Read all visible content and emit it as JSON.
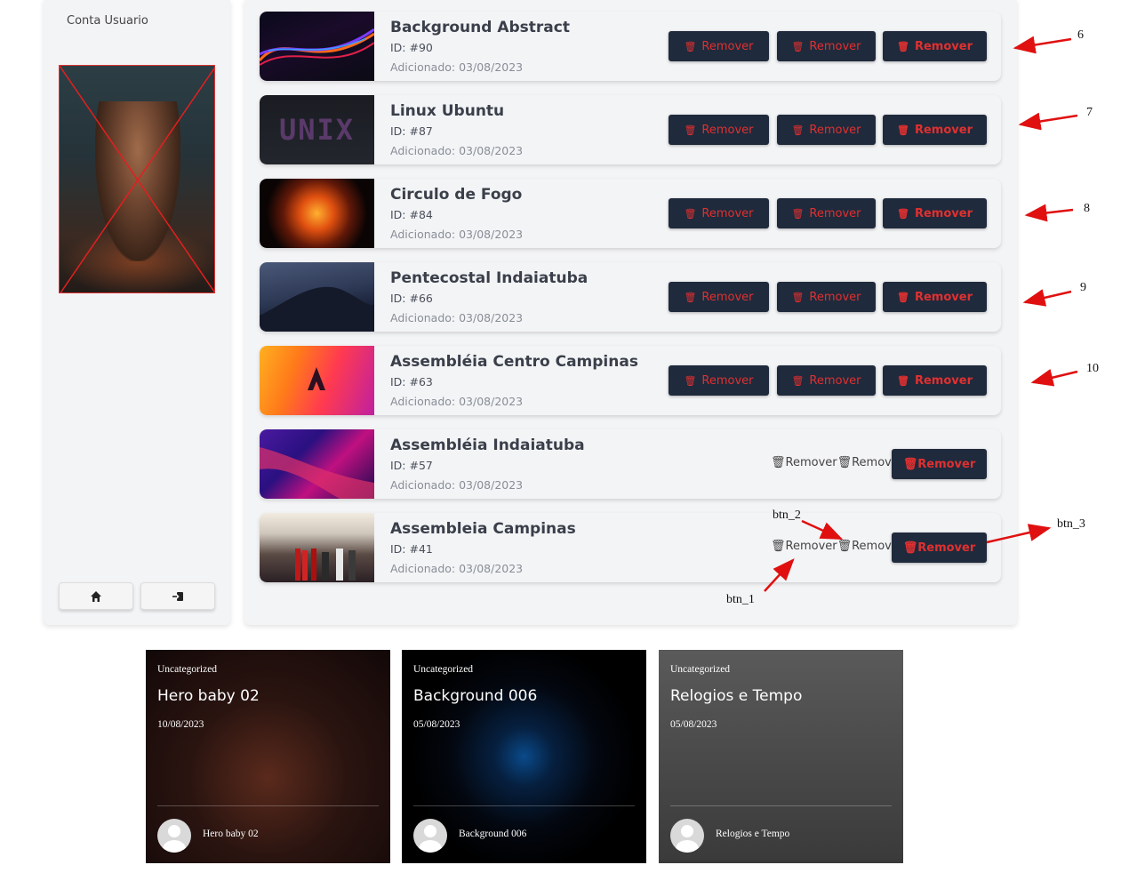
{
  "sidebar": {
    "account_label": "Conta Usuario",
    "home_icon": "home-icon",
    "logout_icon": "logout-icon"
  },
  "rows": [
    {
      "title": "Background Abstract",
      "id": "ID: #90",
      "added": "Adicionado: 03/08/2023",
      "b1": "Remover",
      "b2": "Remover",
      "b3": "Remover",
      "anno": "6"
    },
    {
      "title": "Linux Ubuntu",
      "id": "ID: #87",
      "added": "Adicionado: 03/08/2023",
      "b1": "Remover",
      "b2": "Remover",
      "b3": "Remover",
      "anno": "7",
      "thumb_text": "UNIX"
    },
    {
      "title": "Circulo de Fogo",
      "id": "ID: #84",
      "added": "Adicionado: 03/08/2023",
      "b1": "Remover",
      "b2": "Remover",
      "b3": "Remover",
      "anno": "8"
    },
    {
      "title": "Pentecostal Indaiatuba",
      "id": "ID: #66",
      "added": "Adicionado: 03/08/2023",
      "b1": "Remover",
      "b2": "Remover",
      "b3": "Remover",
      "anno": "9"
    },
    {
      "title": "Assembléia Centro Campinas",
      "id": "ID: #63",
      "added": "Adicionado: 03/08/2023",
      "b1": "Remover",
      "b2": "Remover",
      "b3": "Remover",
      "anno": "10"
    },
    {
      "title": "Assembléia Indaiatuba",
      "id": "ID: #57",
      "added": "Adicionado: 03/08/2023",
      "plain": "🗑Remover🗑Remover",
      "b3": "🗑Remover"
    },
    {
      "title": "Assembleia Campinas",
      "id": "ID: #41",
      "added": "Adicionado: 03/08/2023",
      "plain": "🗑Remover🗑Remover",
      "b3": "🗑Remover"
    }
  ],
  "annotations": {
    "btn1": "btn_1",
    "btn2": "btn_2",
    "btn3": "btn_3"
  },
  "cards": [
    {
      "category": "Uncategorized",
      "title": "Hero baby 02",
      "date": "10/08/2023",
      "author": "Hero baby 02"
    },
    {
      "category": "Uncategorized",
      "title": "Background 006",
      "date": "05/08/2023",
      "author": "Background 006"
    },
    {
      "category": "Uncategorized",
      "title": "Relogios e Tempo",
      "date": "05/08/2023",
      "author": "Relogios e Tempo"
    }
  ],
  "colors": {
    "button_bg": "#1f2a3c",
    "button_text": "#e03030",
    "annotation_arrow": "#e01010"
  }
}
